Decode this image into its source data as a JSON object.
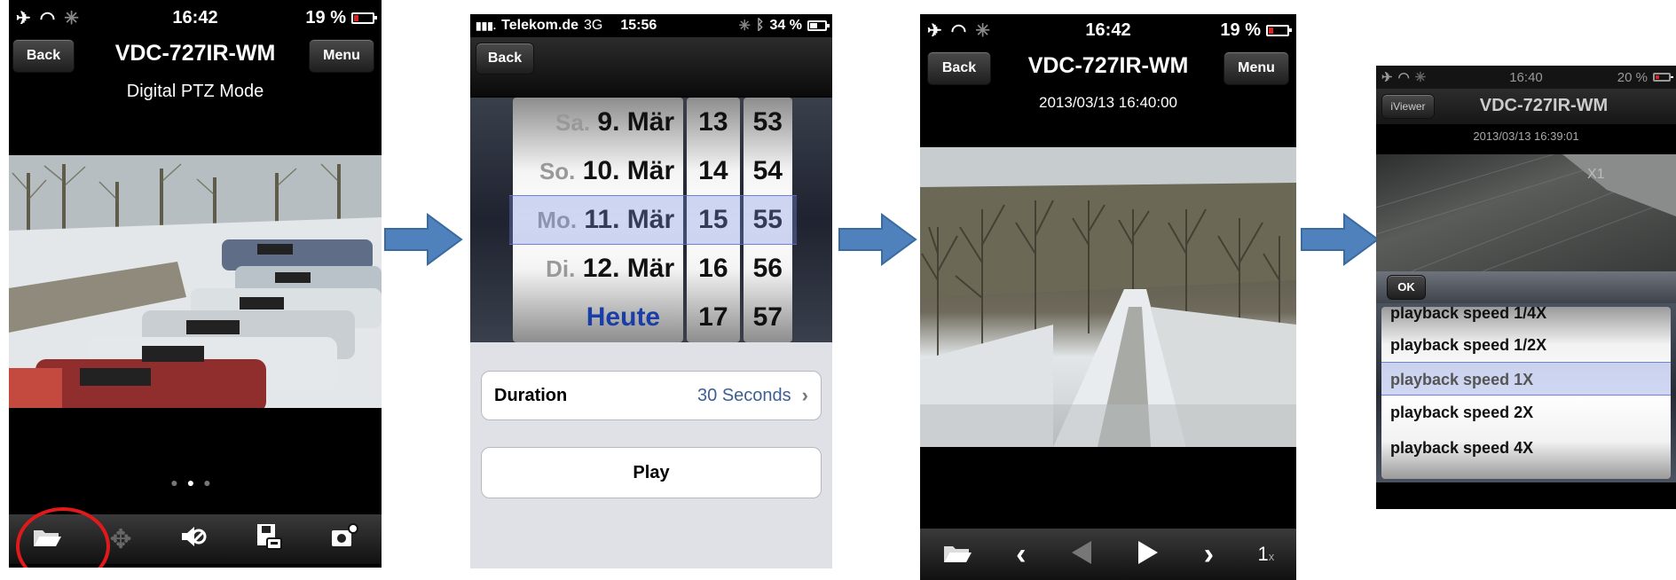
{
  "screen1": {
    "status": {
      "time": "16:42",
      "battery": "19 %",
      "battery_level": 0.19
    },
    "nav": {
      "back": "Back",
      "title": "VDC-727IR-WM",
      "menu": "Menu"
    },
    "subtitle": "Digital PTZ Mode",
    "toolbar_icons": [
      "folder-icon",
      "move-icon",
      "speaker-mute-icon",
      "save-icon",
      "camera-settings-icon"
    ],
    "highlight_color": "#e01a1a"
  },
  "screen2": {
    "status": {
      "carrier": "Telekom.de",
      "network": "3G",
      "time": "15:56",
      "battery": "34 %",
      "battery_level": 0.34
    },
    "nav": {
      "back": "Back"
    },
    "picker": {
      "days": [
        {
          "prefix": "Sa.",
          "date": "9. Mär"
        },
        {
          "prefix": "So.",
          "date": "10. Mär"
        },
        {
          "prefix": "Mo.",
          "date": "11. Mär"
        },
        {
          "prefix": "Di.",
          "date": "12. Mär"
        },
        {
          "prefix": "",
          "date": "Heute"
        }
      ],
      "hours": [
        "13",
        "14",
        "15",
        "16",
        "17"
      ],
      "minutes": [
        "53",
        "54",
        "55",
        "56",
        "57"
      ]
    },
    "duration": {
      "label": "Duration",
      "value": "30 Seconds"
    },
    "play": "Play"
  },
  "screen3": {
    "status": {
      "time": "16:42",
      "battery": "19 %",
      "battery_level": 0.19
    },
    "nav": {
      "back": "Back",
      "title": "VDC-727IR-WM",
      "menu": "Menu"
    },
    "timestamp": "2013/03/13 16:40:00",
    "speed": "1",
    "speed_suffix": "x"
  },
  "screen4": {
    "status": {
      "time": "16:40",
      "battery": "20 %",
      "battery_level": 0.2
    },
    "nav": {
      "back": "iViewer",
      "title": "VDC-727IR-WM"
    },
    "timestamp": "2013/03/13 16:39:01",
    "zoom_label": "X1",
    "ok": "OK",
    "speeds": [
      "playback speed 1/4X",
      "playback speed 1/2X",
      "playback speed 1X",
      "playback speed 2X",
      "playback speed 4X"
    ],
    "selected_index": 2
  },
  "colors": {
    "arrow": "#4f81bd",
    "arrow_border": "#3a6a9e",
    "picker_blue": "#1a3ea8",
    "duration_value": "#3d5f93"
  }
}
